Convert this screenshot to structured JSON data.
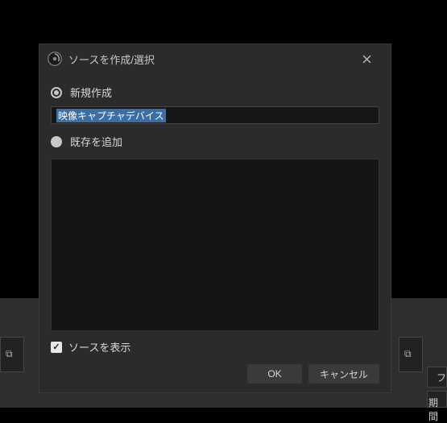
{
  "dialog": {
    "title": "ソースを作成/選択",
    "radio_create_label": "新規作成",
    "input_value": "映像キャプチャデバイス",
    "radio_existing_label": "既存を追加",
    "checkbox_label": "ソースを表示",
    "ok_label": "OK",
    "cancel_label": "キャンセル"
  },
  "bg": {
    "right_label1": "フ",
    "right_label2": "期間"
  }
}
